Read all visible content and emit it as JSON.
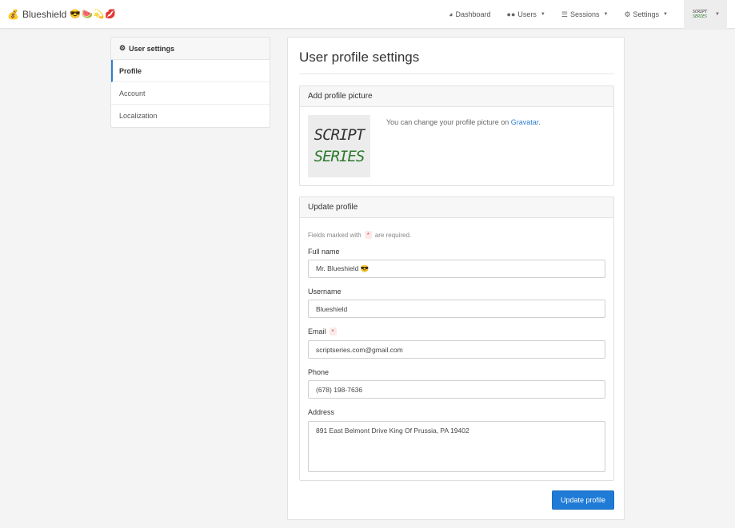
{
  "brand": {
    "name": "Blueshield",
    "emoji": "😎🍉💫💋",
    "icon": "money-bag-icon"
  },
  "nav": {
    "items": [
      {
        "label": "Dashboard",
        "icon": "dashboard-icon",
        "dropdown": false
      },
      {
        "label": "Users",
        "icon": "users-icon",
        "dropdown": true
      },
      {
        "label": "Sessions",
        "icon": "list-icon",
        "dropdown": true
      },
      {
        "label": "Settings",
        "icon": "gear-icon",
        "dropdown": true
      }
    ],
    "avatar": {
      "line1": "SCRIPT",
      "line2": "SERIES"
    }
  },
  "sidebar": {
    "title": "User settings",
    "items": [
      {
        "label": "Profile",
        "active": true
      },
      {
        "label": "Account",
        "active": false
      },
      {
        "label": "Localization",
        "active": false
      }
    ]
  },
  "main": {
    "title": "User profile settings",
    "picture_panel": {
      "title": "Add profile picture",
      "pic_line1": "SCRIPT",
      "pic_line2": "SERIES",
      "note_text": "You can change your profile picture on ",
      "note_link": "Gravatar",
      "note_end": "."
    },
    "form_panel": {
      "title": "Update profile",
      "req_pre": "Fields marked with",
      "req_mark": "*",
      "req_post": "are required.",
      "fields": {
        "full_name": {
          "label": "Full name",
          "value": "Mr. Blueshield 😎"
        },
        "username": {
          "label": "Username",
          "value": "Blueshield"
        },
        "email": {
          "label": "Email",
          "value": "scriptseries.com@gmail.com",
          "required": true
        },
        "phone": {
          "label": "Phone",
          "value": "(678) 198-7636"
        },
        "address": {
          "label": "Address",
          "value": "891 East Belmont Drive King Of Prussia, PA 19402"
        }
      }
    },
    "submit_label": "Update profile"
  },
  "colors": {
    "accent": "#1f7bd6",
    "required": "#d9534f",
    "brand_green": "#2b7a2b"
  }
}
